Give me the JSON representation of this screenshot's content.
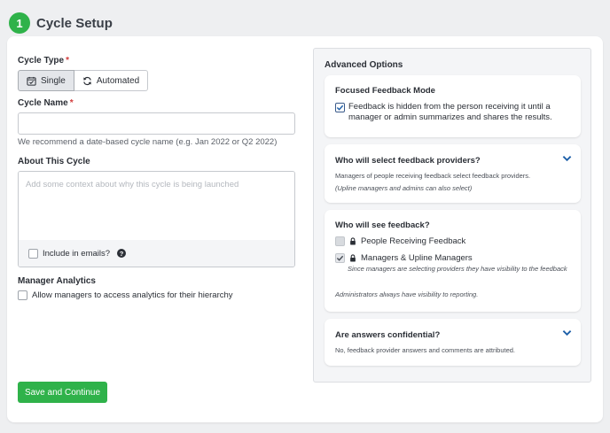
{
  "header": {
    "step": "1",
    "title": "Cycle Setup"
  },
  "form": {
    "cycle_type_label": "Cycle Type",
    "required_mark": "*",
    "cycle_type_options": {
      "single": "Single",
      "automated": "Automated"
    },
    "cycle_name_label": "Cycle Name",
    "cycle_name_value": "",
    "cycle_name_hint": "We recommend a date-based cycle name (e.g. Jan 2022 or Q2 2022)",
    "about_label": "About This Cycle",
    "about_placeholder": "Add some context about why this cycle is being launched",
    "include_emails_label": "Include in emails?",
    "help_mark": "?",
    "manager_analytics_label": "Manager Analytics",
    "manager_analytics_option": "Allow managers to access analytics for their hierarchy",
    "save_label": "Save and Continue"
  },
  "advanced": {
    "title": "Advanced Options",
    "focused": {
      "title": "Focused Feedback Mode",
      "option": "Feedback is hidden from the person receiving it until a manager or admin summarizes and shares the results.",
      "checked": true
    },
    "providers": {
      "title": "Who will select feedback providers?",
      "desc": "Managers of people receiving feedback select feedback providers.",
      "note": "(Upline managers and admins can also select)"
    },
    "visibility": {
      "title": "Who will see feedback?",
      "option1": "People Receiving Feedback",
      "option2": "Managers & Upline Managers",
      "option2_note": "Since managers are selecting providers they have visibility to the feedback",
      "footer": "Administrators always have visibility to reporting."
    },
    "confidential": {
      "title": "Are answers confidential?",
      "desc": "No, feedback provider answers and comments are attributed."
    }
  },
  "colors": {
    "accent": "#2fb24a",
    "link": "#1d5fa8"
  }
}
